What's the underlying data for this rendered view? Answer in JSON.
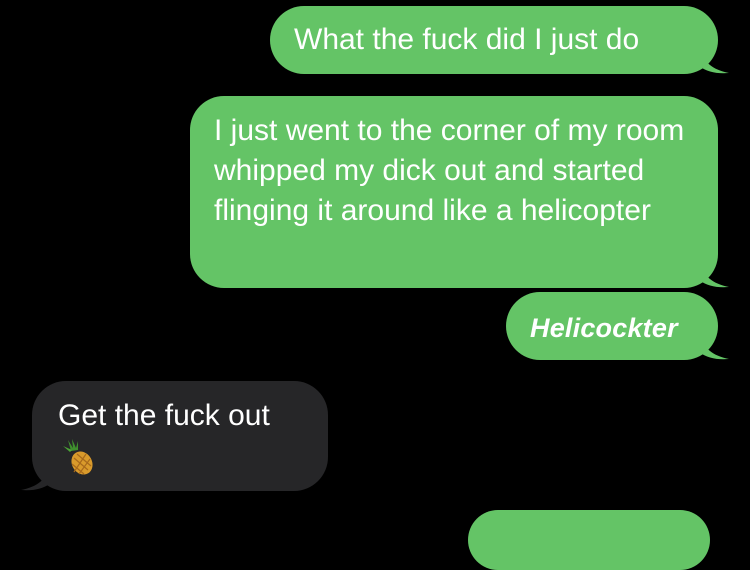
{
  "conversation": {
    "messages": [
      {
        "direction": "sent",
        "text": "What the fuck did I just do"
      },
      {
        "direction": "sent",
        "text": "I just went to the corner of my room whipped my dick out and started flinging it around like a helicopter"
      },
      {
        "direction": "sent",
        "text": "Helicockter",
        "effect": "bold-italic"
      },
      {
        "direction": "received",
        "text": "Get the fuck out",
        "attachment_icon": "pineapple-icon"
      }
    ]
  },
  "colors": {
    "background": "#000000",
    "sent_bubble": "#64c466",
    "received_bubble": "#262628",
    "text": "#ffffff"
  }
}
